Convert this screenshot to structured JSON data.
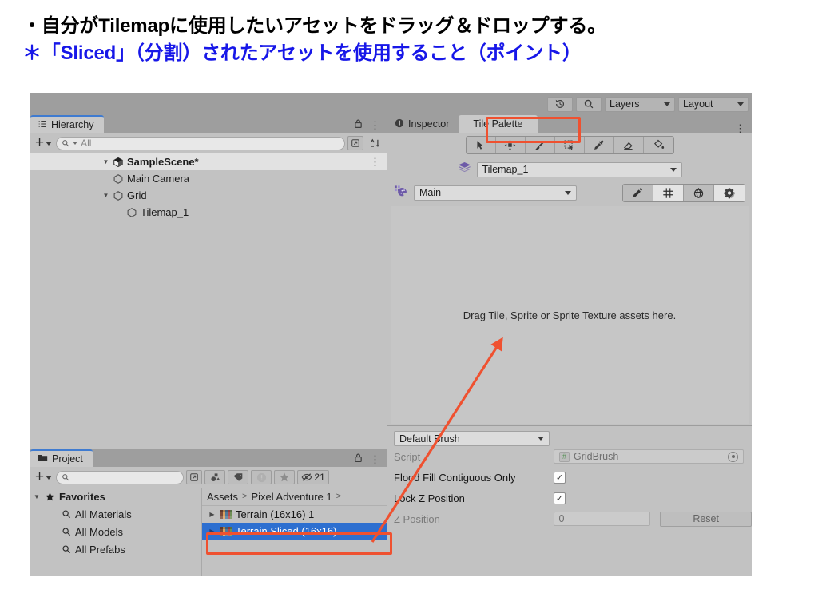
{
  "slide": {
    "caption_line_1": "・自分がTilemapに使用したいアセットをドラッグ＆ドロップする。",
    "caption_line_2": "＊「Sliced」（分割）されたアセットを使用すること（ポイント）",
    "caption_1_color": "#000000",
    "caption_2_color": "#1717e8",
    "annotation_color": "#ef5130"
  },
  "app_toolbar": {
    "history_icon": "history-icon",
    "search_icon": "search-icon",
    "layers_label": "Layers",
    "layout_label": "Layout"
  },
  "hierarchy": {
    "tab_label": "Hierarchy",
    "tab_icon": "hierarchy-icon",
    "lock_icon": "lock-icon",
    "menu_icon": "kebab-menu-icon",
    "add_label": "+",
    "search_value": "All",
    "search_placeholder": "All",
    "tree": [
      {
        "label": "SampleScene*",
        "depth": 0,
        "icon": "unity-scene-icon",
        "bold": true,
        "expanded": true,
        "selected": true
      },
      {
        "label": "Main Camera",
        "depth": 1,
        "icon": "gameobject-icon",
        "bold": false,
        "expanded": null,
        "selected": false
      },
      {
        "label": "Grid",
        "depth": 1,
        "icon": "gameobject-icon",
        "bold": false,
        "expanded": true,
        "selected": false
      },
      {
        "label": "Tilemap_1",
        "depth": 2,
        "icon": "gameobject-icon",
        "bold": false,
        "expanded": null,
        "selected": false
      }
    ]
  },
  "project": {
    "tab_label": "Project",
    "tab_icon": "folder-icon",
    "lock_icon": "lock-icon",
    "menu_icon": "kebab-menu-icon",
    "add_label": "+",
    "search_value": "",
    "search_placeholder": "",
    "filter_icons": [
      "type-filter-icon",
      "label-tag-icon",
      "warning-icon",
      "favorite-star-icon",
      "hidden-eye-icon"
    ],
    "hidden_count": "21",
    "favorites": [
      {
        "label": "Favorites",
        "head": true,
        "icon": "star-icon"
      },
      {
        "label": "All Materials",
        "head": false,
        "icon": "search-icon"
      },
      {
        "label": "All Models",
        "head": false,
        "icon": "search-icon"
      },
      {
        "label": "All Prefabs",
        "head": false,
        "icon": "search-icon"
      }
    ],
    "breadcrumb": [
      "Assets",
      "Pixel Adventure 1"
    ],
    "breadcrumb_trailing": ">",
    "assets": [
      {
        "label": "Terrain (16x16) 1",
        "selected": false,
        "icon": "sprite-sheet-icon"
      },
      {
        "label": "Terrain Sliced (16x16)",
        "selected": true,
        "icon": "sprite-sheet-icon"
      }
    ]
  },
  "inspector": {
    "tabs": [
      {
        "label": "Inspector",
        "icon": "info-icon",
        "active": false,
        "annotated": false
      },
      {
        "label": "Tile Palette",
        "icon": "",
        "active": true,
        "annotated": true
      }
    ],
    "menu_icon": "kebab-menu-icon"
  },
  "tile_palette": {
    "tools": [
      "select-tool-icon",
      "move-tool-icon",
      "paint-brush-tool-icon",
      "box-fill-tool-icon",
      "picker-tool-icon",
      "eraser-tool-icon",
      "flood-fill-tool-icon"
    ],
    "active_tool_index": null,
    "tilemap_icon": "tilemap-layers-icon",
    "tilemap_value": "Tilemap_1",
    "palette_icon": "palette-icon",
    "palette_value": "Main",
    "right_buttons": [
      {
        "icon": "edit-pencil-icon",
        "active": false
      },
      {
        "icon": "grid-icon",
        "active": true
      },
      {
        "icon": "gizmo-globe-icon",
        "active": false
      },
      {
        "icon": "brush-settings-gear-icon",
        "active": true
      }
    ],
    "drop_hint": "Drag Tile, Sprite or Sprite Texture assets here."
  },
  "brush_settings": {
    "brush_name": "Default Brush",
    "rows": [
      {
        "label": "Script",
        "type": "object",
        "value": "GridBrush",
        "dim": true,
        "badge": "#"
      },
      {
        "label": "Flood Fill Contiguous Only",
        "type": "checkbox",
        "checked": true,
        "dim": false
      },
      {
        "label": "Lock Z Position",
        "type": "checkbox",
        "checked": true,
        "dim": false
      },
      {
        "label": "Z Position",
        "type": "number",
        "value": "0",
        "dim": true,
        "button": "Reset"
      }
    ]
  }
}
